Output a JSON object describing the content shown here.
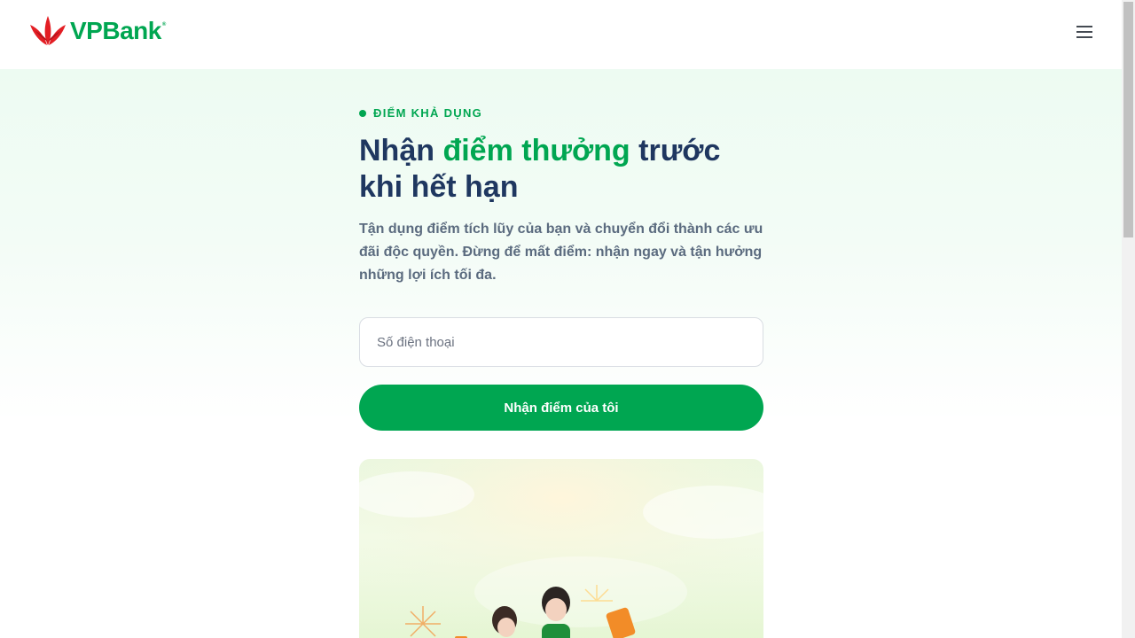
{
  "brand": {
    "name": "VPBank",
    "mark": "®",
    "primary_color": "#00a651",
    "logo_color": "#e31e24"
  },
  "header": {
    "menu_icon": "hamburger-menu-icon"
  },
  "hero": {
    "eyebrow": "ĐIỂM KHẢ DỤNG",
    "title_part1": "Nhận ",
    "title_highlight": "điểm thưởng",
    "title_part2": " trước khi hết hạn",
    "description": "Tận dụng điểm tích lũy của bạn và chuyển đổi thành các ưu đãi độc quyền. Đừng để mất điểm: nhận ngay và tận hưởng những lợi ích tối đa.",
    "phone_placeholder": "Số điện thoại",
    "phone_value": "",
    "cta_label": "Nhận điểm của tôi"
  }
}
